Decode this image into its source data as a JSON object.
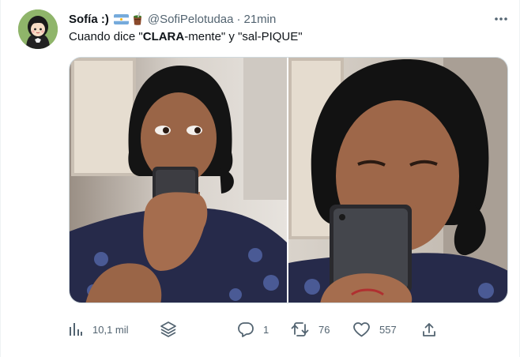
{
  "tweet": {
    "author_name": "Sofía :)",
    "handle": "@SofiPelotudaa",
    "separator": "·",
    "time": "21min",
    "text_parts": {
      "p1": "Cuando dice \"",
      "p2": "CLARA",
      "p3": "-mente\" y \"sal-PIQUE\""
    },
    "flag_icon": "argentina-flag-icon",
    "mate_icon": "mate-cup-icon"
  },
  "actions": {
    "views": "10,1 mil",
    "reply": "1",
    "retweet": "76",
    "like": "557"
  },
  "colors": {
    "text_primary": "#0f1419",
    "text_secondary": "#536471",
    "border": "#cfd9de",
    "flag_blue": "#75aadb"
  }
}
